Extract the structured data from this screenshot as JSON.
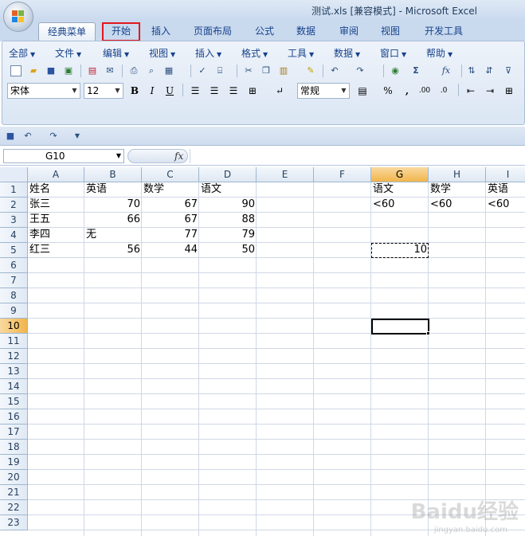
{
  "window": {
    "title": "测试.xls  [兼容模式] - Microsoft Excel"
  },
  "ribbon_tabs": [
    "经典菜单",
    "开始",
    "插入",
    "页面布局",
    "公式",
    "数据",
    "审阅",
    "视图",
    "开发工具"
  ],
  "menus": [
    "全部",
    "文件",
    "编辑",
    "视图",
    "插入",
    "格式",
    "工具",
    "数据",
    "窗口",
    "帮助"
  ],
  "toolbar": {
    "font_name": "宋体",
    "font_size": "12",
    "bold": "B",
    "italic": "I",
    "underline": "U",
    "number_format": "常规",
    "sigma": "Σ",
    "fx": "fx",
    "percent": "%",
    "comma": ","
  },
  "formula_bar": {
    "name_box": "G10",
    "fx_label": "fx",
    "content": ""
  },
  "columns": [
    "A",
    "B",
    "C",
    "D",
    "E",
    "F",
    "G",
    "H",
    "I"
  ],
  "rows": [
    "1",
    "2",
    "3",
    "4",
    "5",
    "6",
    "7",
    "8",
    "9",
    "10",
    "11",
    "12",
    "13",
    "14",
    "15",
    "16",
    "17",
    "18",
    "19",
    "20",
    "21",
    "22",
    "23"
  ],
  "cells": {
    "A1": "姓名",
    "B1": "英语",
    "C1": "数学",
    "D1": "语文",
    "A2": "张三",
    "B2": "70",
    "C2": "67",
    "D2": "90",
    "A3": "王五",
    "B3": "66",
    "C3": "67",
    "D3": "88",
    "A4": "李四",
    "B4": "无",
    "C4": "77",
    "D4": "79",
    "A5": "红三",
    "B5": "56",
    "C5": "44",
    "D5": "50",
    "G1": "语文",
    "H1": "数学",
    "I1": "英语",
    "G2": "<60",
    "H2": "<60",
    "I2": "<60",
    "G5": "10"
  },
  "watermark": {
    "text": "Baidu经验",
    "sub": "jingyan.baidu.com"
  },
  "colors": {
    "highlight_box": "#e0191c",
    "selected_header": "#f1b54c"
  }
}
